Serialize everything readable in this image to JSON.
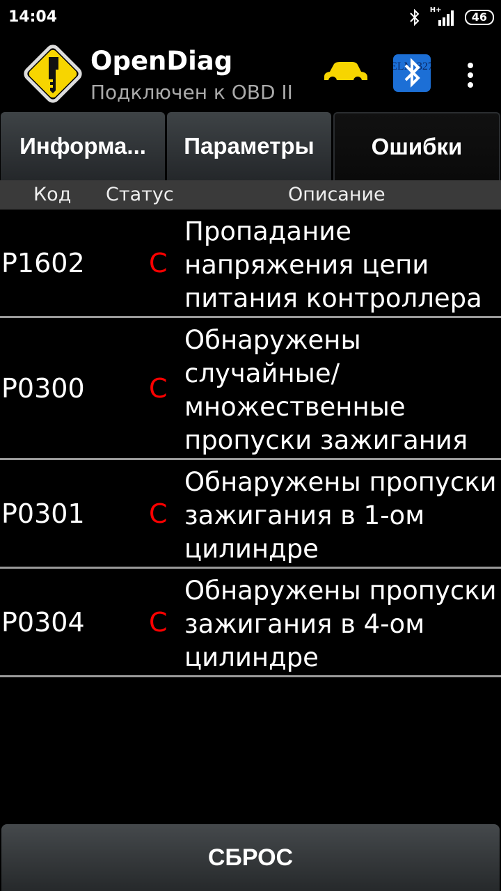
{
  "status_bar": {
    "time": "14:04",
    "network": "H+",
    "battery": "46"
  },
  "app": {
    "title": "OpenDiag",
    "subtitle": "Подключен к OBD II",
    "bt_badge": "ELM 327"
  },
  "tabs": [
    {
      "label": "Информа...",
      "active": false
    },
    {
      "label": "Параметры",
      "active": false
    },
    {
      "label": "Ошибки",
      "active": true
    }
  ],
  "table": {
    "headers": {
      "code": "Код",
      "status": "Статус",
      "description": "Описание"
    },
    "rows": [
      {
        "code": "P1602",
        "status": "C",
        "lines": [
          "Пропадание",
          "напряжения цепи",
          "питания контроллера"
        ]
      },
      {
        "code": "P0300",
        "status": "C",
        "lines": [
          "Обнаружены",
          "случайные/",
          "множественные",
          "пропуски зажигания"
        ]
      },
      {
        "code": "P0301",
        "status": "C",
        "lines": [
          "Обнаружены пропуски",
          "зажигания в 1-ом",
          "цилиндре"
        ]
      },
      {
        "code": "P0304",
        "status": "C",
        "lines": [
          "Обнаружены пропуски",
          "зажигания в 4-ом",
          "цилиндре"
        ]
      }
    ]
  },
  "reset_button": {
    "label": "СБРОС"
  },
  "colors": {
    "status_error": "#ff0000",
    "accent_yellow": "#f7d500"
  }
}
